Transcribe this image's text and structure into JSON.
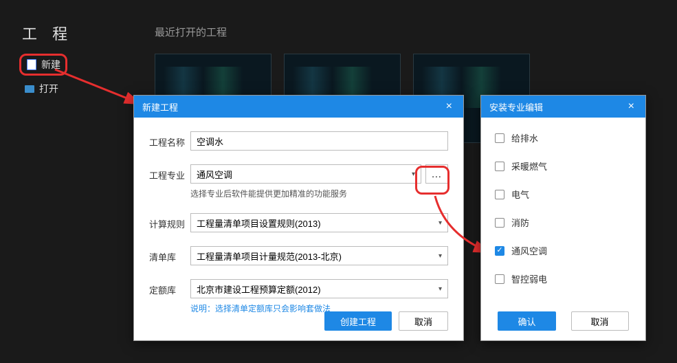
{
  "header": {
    "title": "工 程",
    "recent_label": "最近打开的工程"
  },
  "sidebar": {
    "new_label": "新建",
    "open_label": "打开"
  },
  "new_dialog": {
    "title": "新建工程",
    "name_label": "工程名称",
    "name_value": "空调水",
    "prof_label": "工程专业",
    "prof_value": "通风空调",
    "prof_more": "...",
    "prof_hint": "选择专业后软件能提供更加精准的功能服务",
    "rule_label": "计算规则",
    "rule_value": "工程量清单项目设置规则(2013)",
    "list_label": "清单库",
    "list_value": "工程量清单项目计量规范(2013-北京)",
    "quota_label": "定额库",
    "quota_value": "北京市建设工程预算定额(2012)",
    "quota_hint": "说明：选择清单定额库只会影响套做法",
    "create_btn": "创建工程",
    "cancel_btn": "取消"
  },
  "prof_dialog": {
    "title": "安装专业编辑",
    "options": [
      "给排水",
      "采暖燃气",
      "电气",
      "消防",
      "通风空调",
      "智控弱电"
    ],
    "checked_index": 4,
    "ok_btn": "确认",
    "cancel_btn": "取消"
  },
  "colors": {
    "accent": "#1e88e5",
    "highlight": "#e62e2e"
  }
}
